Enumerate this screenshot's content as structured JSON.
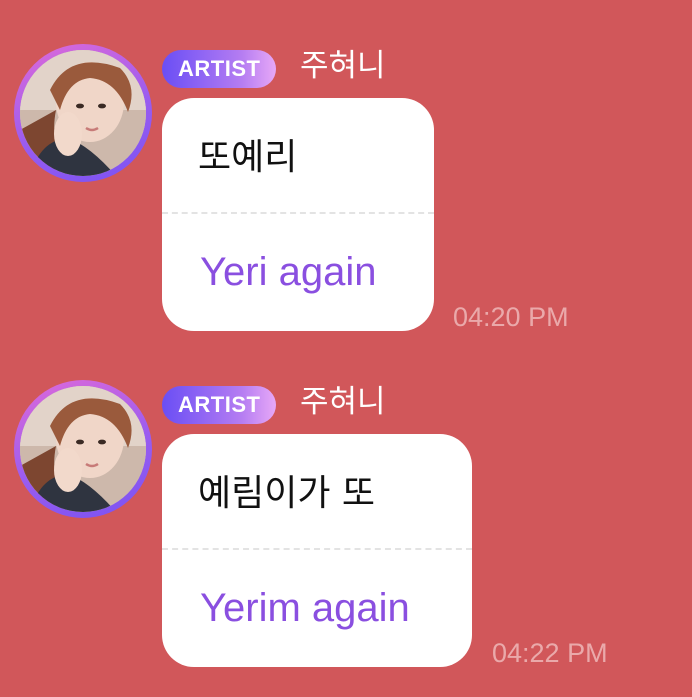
{
  "messages": [
    {
      "badge": "ARTIST",
      "sender": "주혀니",
      "original": "또예리",
      "translation": "Yeri again",
      "time": "04:20 PM"
    },
    {
      "badge": "ARTIST",
      "sender": "주혀니",
      "original": "예림이가 또",
      "translation": "Yerim again",
      "time": "04:22 PM"
    }
  ],
  "colors": {
    "background": "#d1575a",
    "bubble": "#ffffff",
    "translation_text": "#8a4fe0",
    "badge_gradient_start": "#6a4ef5",
    "badge_gradient_end": "#e7a8f7",
    "avatar_ring": "#9a5cf0"
  },
  "icons": {
    "avatar": "profile-photo-avatar"
  }
}
